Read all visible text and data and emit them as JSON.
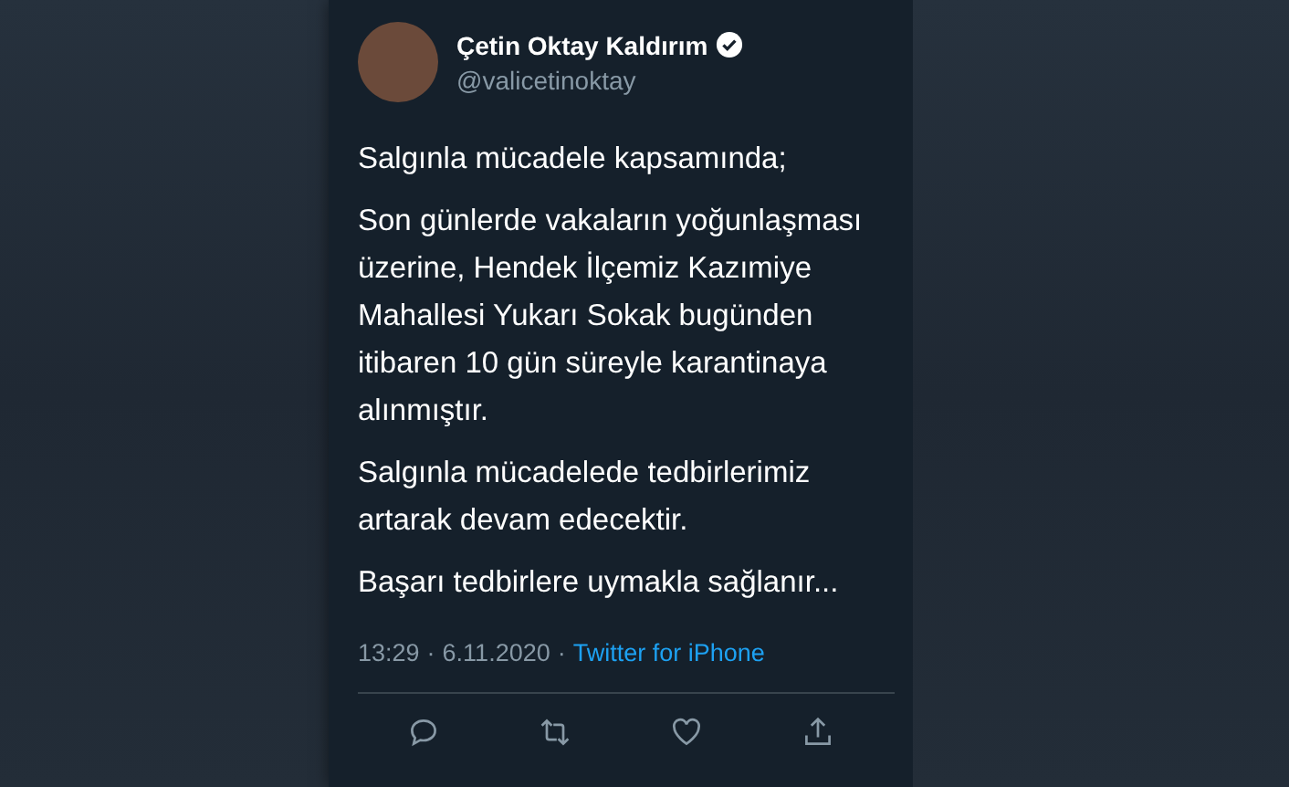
{
  "author": {
    "name": "Çetin Oktay Kaldırım",
    "handle": "@valicetinoktay",
    "verified": true
  },
  "paragraphs": [
    "Salgınla mücadele kapsamında;",
    "Son günlerde vakaların yoğunlaşması üzerine, Hendek İlçemiz Kazımiye Mahallesi Yukarı Sokak bugünden itibaren 10 gün süreyle karantinaya alınmıştır.",
    "Salgınla mücadelede tedbirlerimiz artarak devam edecektir.",
    "Başarı tedbirlere uymakla sağlanır..."
  ],
  "meta": {
    "time": "13:29",
    "separator": "·",
    "date": "6.11.2020",
    "source": "Twitter for iPhone"
  },
  "actions": [
    {
      "kind": "reply"
    },
    {
      "kind": "retweet"
    },
    {
      "kind": "like"
    },
    {
      "kind": "share"
    }
  ]
}
